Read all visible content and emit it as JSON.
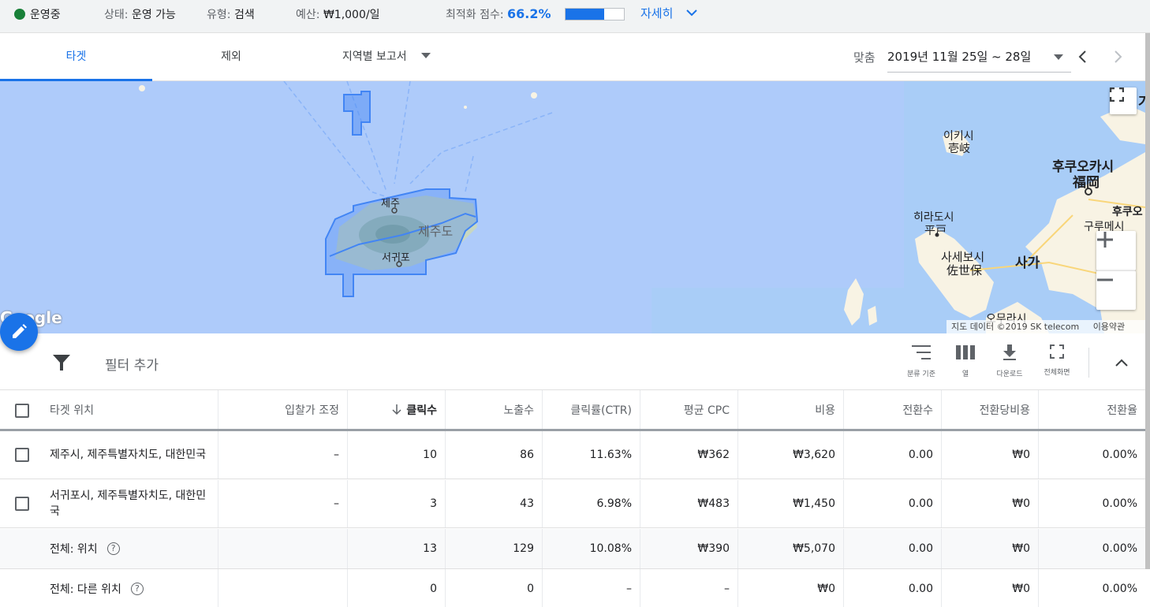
{
  "status_bar": {
    "status": "운영중",
    "state_label": "상태:",
    "state_value": "운영 가능",
    "type_label": "유형:",
    "type_value": "검색",
    "budget_label": "예산:",
    "budget_value": "₩1,000/일",
    "score_label": "최적화 점수:",
    "score_value": "66.2%",
    "score_fraction": 0.662,
    "details_label": "자세히"
  },
  "tabs": [
    {
      "label": "타겟",
      "active": true
    },
    {
      "label": "제외",
      "active": false
    },
    {
      "label": "지역별 보고서",
      "active": false
    }
  ],
  "date": {
    "label": "맞춤",
    "range": "2019년 11월 25일 ~ 28일"
  },
  "map": {
    "labels": {
      "jeju": "제주",
      "jeju_island": "제주도",
      "seogwipo": "서귀포",
      "iki_kr": "이키시",
      "iki_jp": "壱岐",
      "fukuoka_kr": "후쿠오카시",
      "fukuoka_jp": "福岡",
      "hirado_kr": "히라도시",
      "hirado_jp": "平戸",
      "sasebo_kr": "사세보시",
      "sasebo_jp": "佐世保",
      "saga": "사가",
      "kurume": "구루메시",
      "omura": "오무라시",
      "fuku_partial": "후쿠오",
      "top_right": "가"
    },
    "attribution": "지도 데이터 ©2019 SK telecom",
    "terms": "이용약관",
    "google": "Google"
  },
  "filter": {
    "add_filter": "필터 추가",
    "tools": {
      "segment": "분류 기준",
      "columns": "열",
      "download": "다운로드",
      "fullscreen": "전체화면"
    }
  },
  "table": {
    "headers": {
      "location": "타겟 위치",
      "bid_adj": "입찰가 조정",
      "clicks": "클릭수",
      "impr": "노출수",
      "ctr": "클릭률(CTR)",
      "cpc": "평균 CPC",
      "cost": "비용",
      "conv": "전환수",
      "cost_per_conv": "전환당비용",
      "conv_rate": "전환율"
    },
    "rows": [
      {
        "location": "제주시, 제주특별자치도, 대한민국",
        "bid_adj": "–",
        "clicks": "10",
        "impr": "86",
        "ctr": "11.63%",
        "cpc": "₩362",
        "cost": "₩3,620",
        "conv": "0.00",
        "cost_per_conv": "₩0",
        "conv_rate": "0.00%"
      },
      {
        "location": "서귀포시, 제주특별자치도, 대한민국",
        "bid_adj": "–",
        "clicks": "3",
        "impr": "43",
        "ctr": "6.98%",
        "cpc": "₩483",
        "cost": "₩1,450",
        "conv": "0.00",
        "cost_per_conv": "₩0",
        "conv_rate": "0.00%"
      }
    ],
    "totals": [
      {
        "location": "전체: 위치",
        "clicks": "13",
        "impr": "129",
        "ctr": "10.08%",
        "cpc": "₩390",
        "cost": "₩5,070",
        "conv": "0.00",
        "cost_per_conv": "₩0",
        "conv_rate": "0.00%"
      },
      {
        "location": "전체: 다른 위치",
        "clicks": "0",
        "impr": "0",
        "ctr": "–",
        "cpc": "–",
        "cost": "₩0",
        "conv": "0.00",
        "cost_per_conv": "₩0",
        "conv_rate": "0.00%"
      }
    ]
  },
  "colors": {
    "accent": "#1a73e8",
    "status_green": "#188038",
    "map_sea": "#aecbfa",
    "map_land": "#f8f3e4"
  }
}
